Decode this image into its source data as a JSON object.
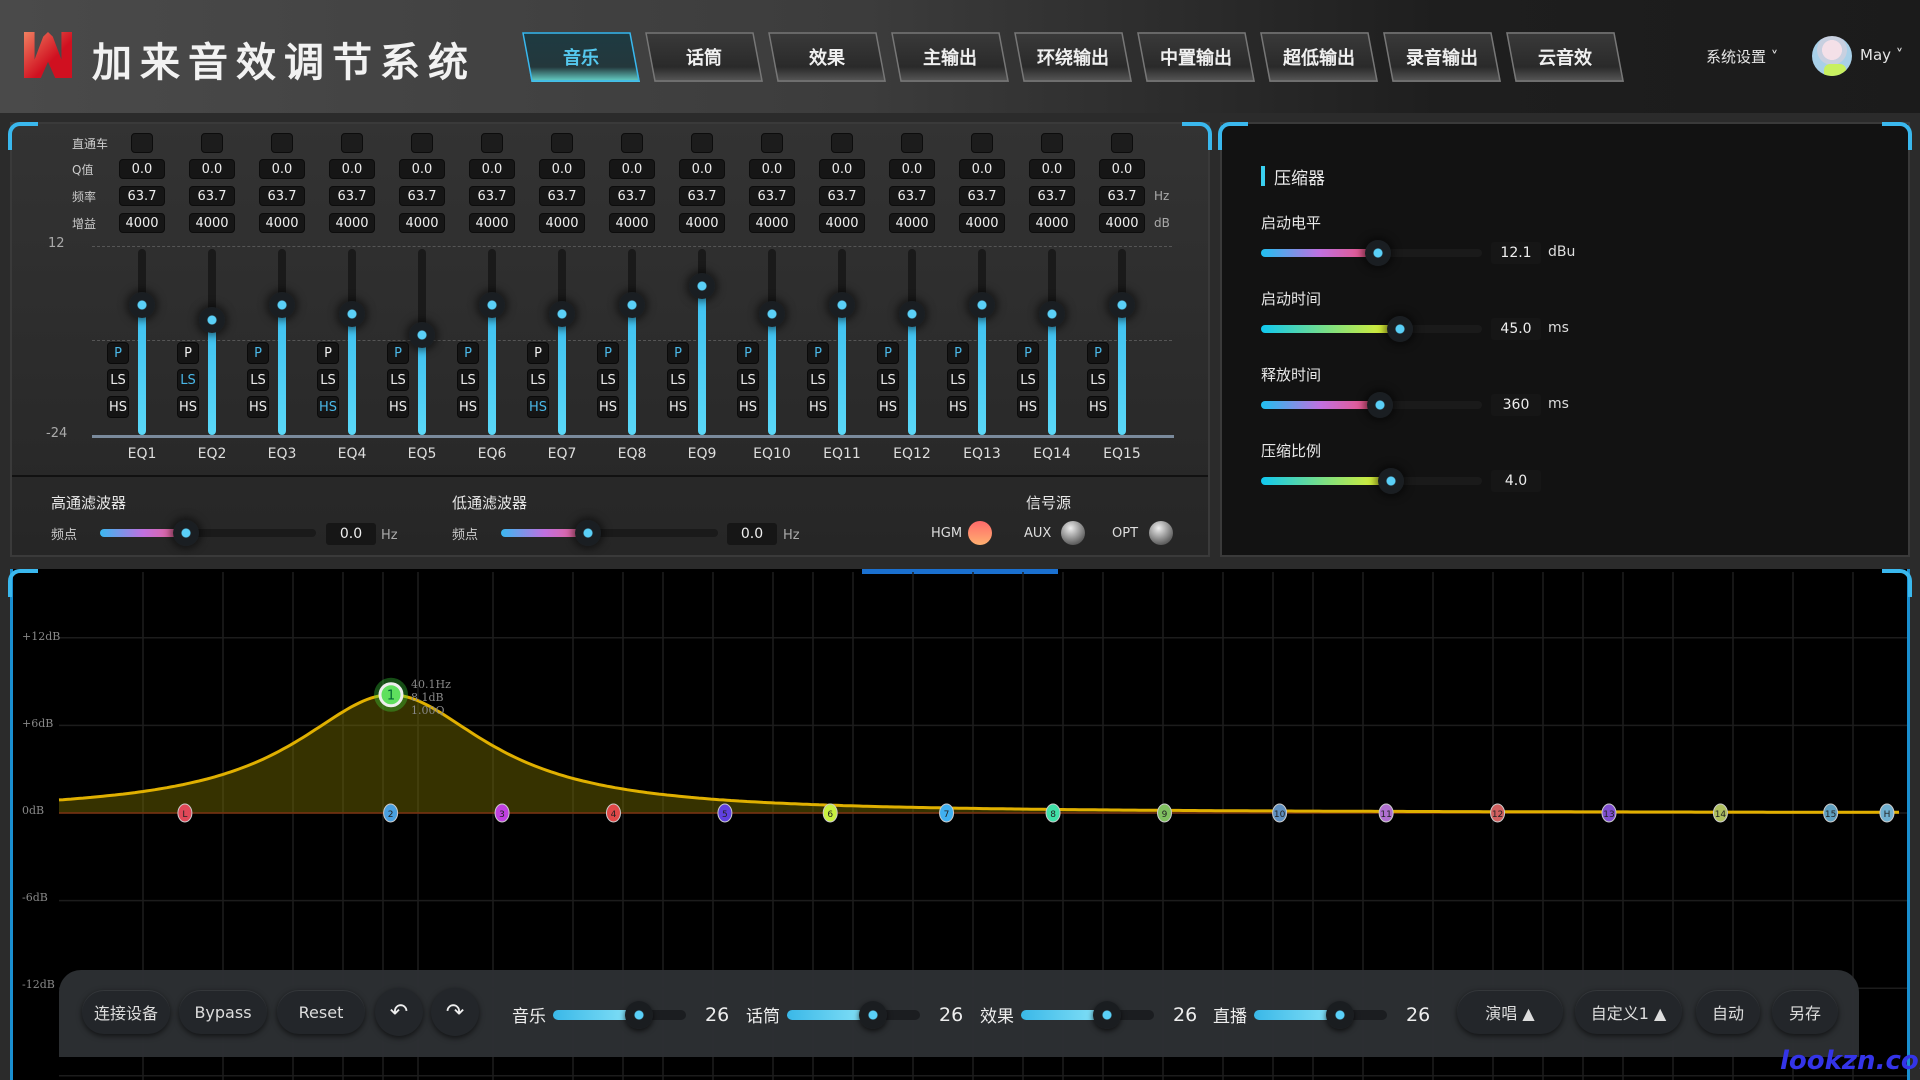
{
  "header": {
    "app_title": "加来音效调节系统",
    "tabs": [
      {
        "label": "音乐",
        "active": true
      },
      {
        "label": "话筒",
        "active": false
      },
      {
        "label": "效果",
        "active": false
      },
      {
        "label": "主输出",
        "active": false
      },
      {
        "label": "环绕输出",
        "active": false
      },
      {
        "label": "中置输出",
        "active": false
      },
      {
        "label": "超低输出",
        "active": false
      },
      {
        "label": "录音输出",
        "active": false
      },
      {
        "label": "云音效",
        "active": false
      }
    ],
    "settings_label": "系统设置 ˅",
    "user_name": "May ˅"
  },
  "eq": {
    "row_labels": {
      "bypass": "直通车",
      "q": "Q值",
      "freq": "频率",
      "gain": "增益"
    },
    "freq_unit": "Hz",
    "gain_unit": "dB",
    "scale_max": "12",
    "scale_min": "-24",
    "mode_labels": [
      "P",
      "LS",
      "HS"
    ],
    "bands": [
      {
        "name": "EQ1",
        "q": "0.0",
        "freq": "63.7",
        "gain": "4000",
        "mode": "P",
        "level": 0.7
      },
      {
        "name": "EQ2",
        "q": "0.0",
        "freq": "63.7",
        "gain": "4000",
        "mode": "LS",
        "level": 0.62
      },
      {
        "name": "EQ3",
        "q": "0.0",
        "freq": "63.7",
        "gain": "4000",
        "mode": "P",
        "level": 0.7
      },
      {
        "name": "EQ4",
        "q": "0.0",
        "freq": "63.7",
        "gain": "4000",
        "mode": "HS",
        "level": 0.65
      },
      {
        "name": "EQ5",
        "q": "0.0",
        "freq": "63.7",
        "gain": "4000",
        "mode": "P",
        "level": 0.54
      },
      {
        "name": "EQ6",
        "q": "0.0",
        "freq": "63.7",
        "gain": "4000",
        "mode": "P",
        "level": 0.7
      },
      {
        "name": "EQ7",
        "q": "0.0",
        "freq": "63.7",
        "gain": "4000",
        "mode": "HS",
        "level": 0.65
      },
      {
        "name": "EQ8",
        "q": "0.0",
        "freq": "63.7",
        "gain": "4000",
        "mode": "P",
        "level": 0.7
      },
      {
        "name": "EQ9",
        "q": "0.0",
        "freq": "63.7",
        "gain": "4000",
        "mode": "P",
        "level": 0.8
      },
      {
        "name": "EQ10",
        "q": "0.0",
        "freq": "63.7",
        "gain": "4000",
        "mode": "P",
        "level": 0.65
      },
      {
        "name": "EQ11",
        "q": "0.0",
        "freq": "63.7",
        "gain": "4000",
        "mode": "P",
        "level": 0.7
      },
      {
        "name": "EQ12",
        "q": "0.0",
        "freq": "63.7",
        "gain": "4000",
        "mode": "P",
        "level": 0.65
      },
      {
        "name": "EQ13",
        "q": "0.0",
        "freq": "63.7",
        "gain": "4000",
        "mode": "P",
        "level": 0.7
      },
      {
        "name": "EQ14",
        "q": "0.0",
        "freq": "63.7",
        "gain": "4000",
        "mode": "P",
        "level": 0.65
      },
      {
        "name": "EQ15",
        "q": "0.0",
        "freq": "63.7",
        "gain": "4000",
        "mode": "P",
        "level": 0.7
      }
    ]
  },
  "filters": {
    "highpass": {
      "title": "高通滤波器",
      "label": "频点",
      "value": "0.0",
      "unit": "Hz",
      "level": 0.4
    },
    "lowpass": {
      "title": "低通滤波器",
      "label": "频点",
      "value": "0.0",
      "unit": "Hz",
      "level": 0.4
    },
    "source": {
      "title": "信号源",
      "options": [
        {
          "label": "HGM",
          "selected": true
        },
        {
          "label": "AUX",
          "selected": false
        },
        {
          "label": "OPT",
          "selected": false
        }
      ]
    }
  },
  "compressor": {
    "title": "压缩器",
    "params": [
      {
        "label": "启动电平",
        "value": "12.1",
        "unit": "dBu",
        "level": 0.53,
        "gradient": "pink"
      },
      {
        "label": "启动时间",
        "value": "45.0",
        "unit": "ms",
        "level": 0.63,
        "gradient": "yellow"
      },
      {
        "label": "释放时间",
        "value": "360",
        "unit": "ms",
        "level": 0.54,
        "gradient": "pink"
      },
      {
        "label": "压缩比例",
        "value": "4.0",
        "unit": "",
        "level": 0.59,
        "gradient": "yellow"
      }
    ]
  },
  "graph": {
    "y_labels": [
      "+12dB",
      "+6dB",
      "0dB",
      "-6dB",
      "-12dB"
    ],
    "selected_point": {
      "label": "1",
      "freq": "40.1Hz",
      "gain": "8.1dB",
      "q": "1.00Q",
      "gain_db": 8.1
    },
    "markers": [
      {
        "label": "L",
        "color": "#e04858"
      },
      {
        "label": "2",
        "color": "#4aa0e0"
      },
      {
        "label": "3",
        "color": "#c040e0"
      },
      {
        "label": "4",
        "color": "#e04848"
      },
      {
        "label": "5",
        "color": "#6040e0"
      },
      {
        "label": "6",
        "color": "#c8f040"
      },
      {
        "label": "7",
        "color": "#40b0f0"
      },
      {
        "label": "8",
        "color": "#40e0a8"
      },
      {
        "label": "9",
        "color": "#80c060"
      },
      {
        "label": "10",
        "color": "#6090c0"
      },
      {
        "label": "11",
        "color": "#b070d0"
      },
      {
        "label": "12",
        "color": "#d06060"
      },
      {
        "label": "13",
        "color": "#8050d0"
      },
      {
        "label": "14",
        "color": "#b0c060"
      },
      {
        "label": "15",
        "color": "#60a0c0"
      },
      {
        "label": "H",
        "color": "#70b0d0"
      }
    ],
    "curve_color": "#e0b000"
  },
  "bottom_bar": {
    "connect": "连接设备",
    "bypass": "Bypass",
    "reset": "Reset",
    "undo_icon": "undo-icon",
    "redo_icon": "redo-icon",
    "levels": [
      {
        "label": "音乐",
        "value": "26",
        "level": 0.65
      },
      {
        "label": "话筒",
        "value": "26",
        "level": 0.65
      },
      {
        "label": "效果",
        "value": "26",
        "level": 0.65
      },
      {
        "label": "直播",
        "value": "26",
        "level": 0.65
      }
    ],
    "preset_mode": "演唱 ▲",
    "preset_custom": "自定义1 ▲",
    "auto": "自动",
    "save_as": "另存"
  },
  "watermark": "lookzn.com"
}
